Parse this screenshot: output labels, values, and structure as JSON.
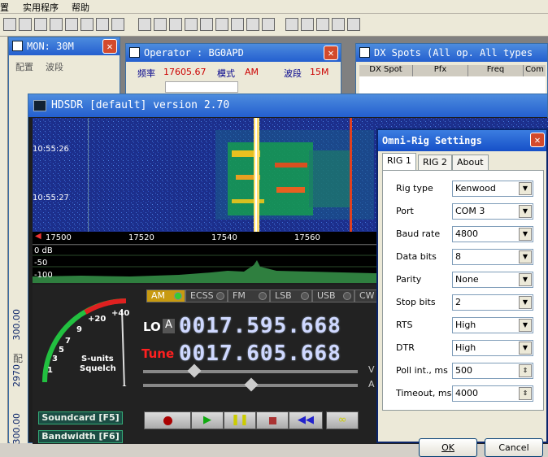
{
  "menubar": {
    "items": [
      "置",
      "实用程序",
      "帮助"
    ]
  },
  "toolbar": {
    "icons": [
      "wrench-icon",
      "antenna-icon",
      "globe-icon",
      "grid-icon",
      "printer-icon",
      "user-icon",
      "satellite-icon",
      "chart-icon",
      "memory-icon",
      "tool-icon",
      "window-icon",
      "fn-icon",
      "hash-icon",
      "map-icon",
      "cube-icon",
      "network-icon",
      "table-icon",
      "clock-icon",
      "go-icon",
      "grid2-icon",
      "bar-icon",
      "wand-icon"
    ]
  },
  "mon_window": {
    "title": "MON: 30M",
    "label1": "配置",
    "label2": "波段",
    "side_freq1": "300.00",
    "side_freq2": "2970",
    "side_freq3": "300.00",
    "side_label": "配"
  },
  "operator_window": {
    "title": "Operator : BG0APD",
    "freq_label": "频率",
    "freq_value": "17605.67",
    "mode_label": "模式",
    "mode_value": "AM",
    "band_label": "波段",
    "band_value": "15M"
  },
  "dx_window": {
    "title": "DX Spots (All op. All types",
    "columns": [
      "DX Spot",
      "Pfx",
      "Freq",
      "Com"
    ]
  },
  "hdsdr": {
    "title": "HDSDR [default]  version 2.70",
    "times": [
      "10:55:26",
      "10:55:27"
    ],
    "freq_ticks": [
      "17500",
      "17520",
      "17540",
      "17560"
    ],
    "db_labels": [
      "0 dB",
      "-50",
      "-100"
    ],
    "modes": [
      "AM",
      "ECSS",
      "FM",
      "LSB",
      "USB",
      "CW"
    ],
    "active_mode": "AM",
    "smeter_labels": [
      "+40",
      "+20",
      "9",
      "7",
      "5",
      "3",
      "1"
    ],
    "smeter_title1": "S-units",
    "smeter_title2": "Squelch",
    "lo_label": "LO",
    "lo_a": "A",
    "lo_freq": "0017.595.668",
    "tune_label": "Tune",
    "tune_freq": "0017.605.668",
    "soundcard_btn": "Soundcard  [F5]",
    "bandwidth_btn": "Bandwidth  [F6]",
    "right_letters": [
      "V",
      "A"
    ],
    "transport": [
      "record-icon",
      "play-icon",
      "pause-icon",
      "stop-icon",
      "rewind-icon",
      "loop-icon"
    ]
  },
  "omnirig": {
    "title": "Omni-Rig Settings",
    "tabs": [
      "RIG 1",
      "RIG 2",
      "About"
    ],
    "fields": [
      {
        "label": "Rig type",
        "value": "Kenwood",
        "kind": "select"
      },
      {
        "label": "Port",
        "value": "COM 3",
        "kind": "select"
      },
      {
        "label": "Baud rate",
        "value": "4800",
        "kind": "select"
      },
      {
        "label": "Data bits",
        "value": "8",
        "kind": "select"
      },
      {
        "label": "Parity",
        "value": "None",
        "kind": "select"
      },
      {
        "label": "Stop bits",
        "value": "2",
        "kind": "select"
      },
      {
        "label": "RTS",
        "value": "High",
        "kind": "select"
      },
      {
        "label": "DTR",
        "value": "High",
        "kind": "select"
      },
      {
        "label": "Poll int., ms",
        "value": "500",
        "kind": "spin"
      },
      {
        "label": "Timeout, ms",
        "value": "4000",
        "kind": "spin"
      }
    ],
    "ok": "OK",
    "cancel": "Cancel"
  },
  "colors": {
    "title_blue": "#245fcf",
    "waterfall_bg": "#1a2f8a",
    "lcd_text": "#cfd8ff",
    "tune_red": "#ff2020",
    "dialog_blue": "#0a246a"
  }
}
